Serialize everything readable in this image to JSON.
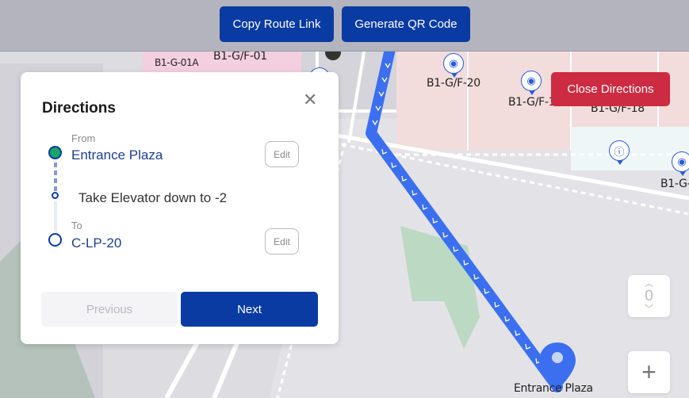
{
  "toolbar": {
    "copy_route_label": "Copy Route Link",
    "generate_qr_label": "Generate QR Code"
  },
  "close_directions_label": "Close Directions",
  "directions": {
    "title": "Directions",
    "from_tag": "From",
    "from_place": "Entrance Plaza",
    "instruction": "Take Elevator down to -2",
    "to_tag": "To",
    "to_place": "C-LP-20",
    "edit_label": "Edit",
    "previous_label": "Previous",
    "next_label": "Next"
  },
  "map": {
    "labels": {
      "b1g01a": "B1-G-01A",
      "b1gf01": "B1-G/F-01",
      "b1gf20": "B1-G/F-20",
      "b1gf1x": "B1-G/F-1",
      "b1gf18": "B1-G/F-18",
      "b1gx": "B1-G-",
      "entrance": "Entrance Plaza"
    },
    "floor_level": "0",
    "zoom_in_label": "+"
  },
  "colors": {
    "primary": "#0a3ba3",
    "danger": "#cc2b42",
    "route": "#3b6ff0",
    "green_dot": "#19a56a"
  }
}
